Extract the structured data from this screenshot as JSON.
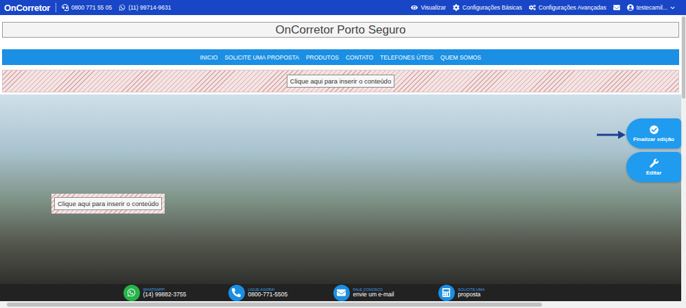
{
  "topbar": {
    "logo": "OnCorretor",
    "phone": "0800 771 55 05",
    "whatsapp": "(11) 99714-9631",
    "actions": [
      {
        "label": "Visualizar",
        "kind": "view"
      },
      {
        "label": "Configurações Básicas",
        "kind": "basic"
      },
      {
        "label": "Configurações Avançadas",
        "kind": "advanced"
      }
    ],
    "user": "testecamil..."
  },
  "site_title": "OnCorretor Porto Seguro",
  "nav": [
    "INICIO",
    "SOLICITE UMA PROPOSTA",
    "PRODUTOS",
    "CONTATO",
    "TELEFONES ÚTEIS",
    "QUEM SOMOS"
  ],
  "content_placeholders": [
    "Clique aqui para inserir o conteúdo",
    "Clique aqui para inserir o conteúdo"
  ],
  "edit_buttons": [
    {
      "label": "Finalizar edição",
      "kind": "finish"
    },
    {
      "label": "Editar",
      "kind": "edit"
    }
  ],
  "footer_contacts": [
    {
      "title": "WHATSAPP!",
      "value": "(14) 99882-3755",
      "kind": "whatsapp",
      "color": "#25b34a"
    },
    {
      "title": "LIGUE AGORA!",
      "value": "0800-771-5505",
      "kind": "phone",
      "color": "#1a8fe3"
    },
    {
      "title": "FALE CONOSCO",
      "value": "envie um e-mail",
      "kind": "mail",
      "color": "#1a8fe3"
    },
    {
      "title": "SOLICITE UMA",
      "value": "proposta",
      "kind": "proposal",
      "color": "#1a8fe3"
    }
  ]
}
